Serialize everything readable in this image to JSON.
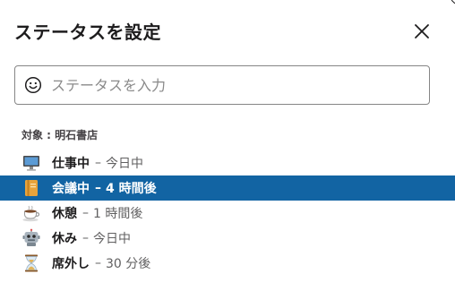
{
  "dialog": {
    "title": "ステータスを設定",
    "close_icon": "close-icon"
  },
  "search": {
    "placeholder": "ステータスを入力",
    "value": "",
    "icon": "smile-icon"
  },
  "target_label": "対象 : 明石書店",
  "presets": [
    {
      "icon": "desktop-computer-icon",
      "name": "仕事中",
      "separator": "–",
      "duration": "今日中",
      "selected": false
    },
    {
      "icon": "notebook-icon",
      "name": "会議中",
      "separator": "–",
      "duration": "4 時間後",
      "selected": true
    },
    {
      "icon": "coffee-icon",
      "name": "休憩",
      "separator": "–",
      "duration": "1 時間後",
      "selected": false
    },
    {
      "icon": "robot-icon",
      "name": "休み",
      "separator": "–",
      "duration": "今日中",
      "selected": false
    },
    {
      "icon": "hourglass-icon",
      "name": "席外し",
      "separator": "–",
      "duration": "30 分後",
      "selected": false
    }
  ],
  "colors": {
    "selected_bg": "#1264a3",
    "text": "#1d1c1d",
    "muted": "#616061",
    "border": "#868686"
  }
}
